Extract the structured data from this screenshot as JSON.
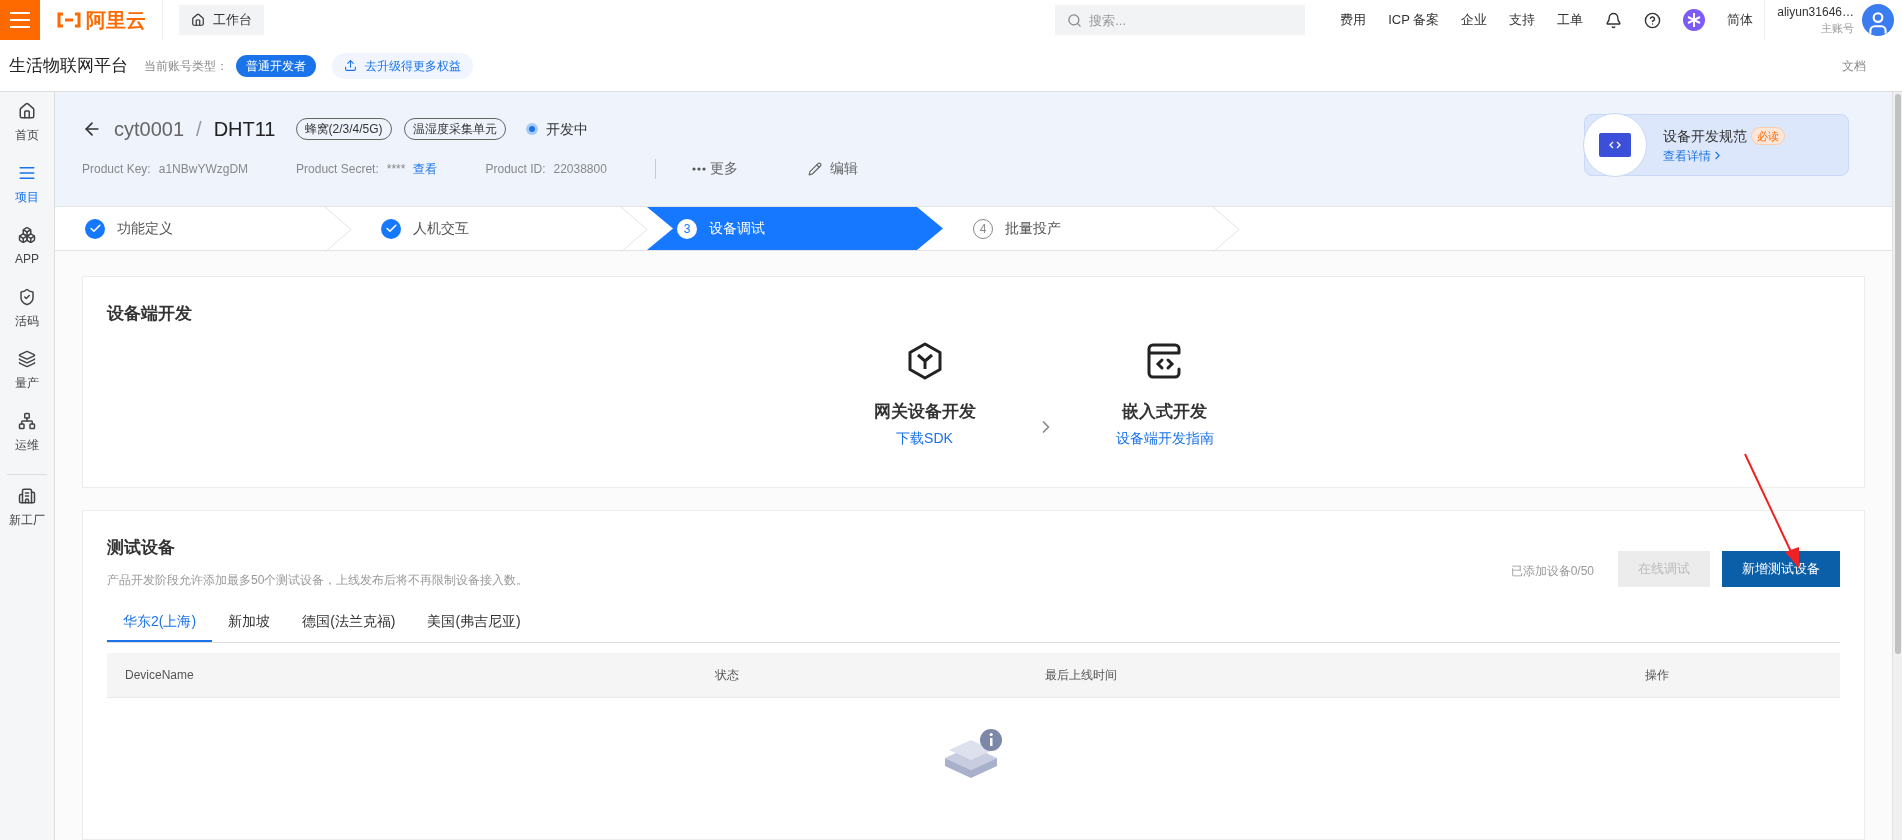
{
  "topbar": {
    "logo": "阿里云",
    "workbench": "工作台",
    "search": {
      "placeholder": "搜索..."
    },
    "links": [
      "费用",
      "ICP 备案",
      "企业",
      "支持",
      "工单"
    ],
    "language": "简体",
    "user": {
      "name": "aliyun31646…",
      "role": "主账号"
    }
  },
  "subheader": {
    "title": "生活物联网平台",
    "account_label": "当前账号类型：",
    "account_type": "普通开发者",
    "upgrade": "去升级得更多权益",
    "docs": "文档"
  },
  "sidebar": {
    "items": [
      {
        "label": "首页",
        "selected": false
      },
      {
        "label": "项目",
        "selected": true
      },
      {
        "label": "APP",
        "selected": false
      },
      {
        "label": "活码",
        "selected": false
      },
      {
        "label": "量产",
        "selected": false
      },
      {
        "label": "运维",
        "selected": false
      },
      {
        "label": "新工厂",
        "selected": false
      }
    ]
  },
  "product": {
    "project": "cyt0001",
    "separator": "/",
    "name": "DHT11",
    "tags": [
      "蜂窝(2/3/4/5G)",
      "温湿度采集单元"
    ],
    "status": "开发中",
    "meta": [
      {
        "label": "Product Key:",
        "value": "a1NBwYWzgDM"
      },
      {
        "label": "Product Secret:",
        "value": "****",
        "link": "查看"
      },
      {
        "label": "Product ID:",
        "value": "22038800"
      }
    ],
    "more": "更多",
    "edit": "编辑",
    "promo": {
      "title": "设备开发规范",
      "badge": "必读",
      "link": "查看详情"
    }
  },
  "steps": [
    {
      "label": "功能定义",
      "completed": true,
      "selected": false
    },
    {
      "label": "人机交互",
      "completed": true,
      "selected": false
    },
    {
      "number": "3",
      "label": "设备调试",
      "completed": false,
      "selected": true
    },
    {
      "number": "4",
      "label": "批量投产",
      "completed": false,
      "selected": false
    }
  ],
  "device_dev": {
    "title": "设备端开发",
    "options": [
      {
        "title": "网关设备开发",
        "link": "下载SDK"
      },
      {
        "title": "嵌入式开发",
        "link": "设备端开发指南"
      }
    ]
  },
  "test_devices": {
    "title": "测试设备",
    "description": "产品开发阶段允许添加最多50个测试设备，上线发布后将不再限制设备接入数。",
    "count": "已添加设备0/50",
    "buttons": [
      {
        "label": "在线调试",
        "disabled": true
      },
      {
        "label": "新增测试设备",
        "disabled": false
      }
    ],
    "tabs": [
      {
        "label": "华东2(上海)",
        "selected": true
      },
      {
        "label": "新加坡",
        "selected": false
      },
      {
        "label": "德国(法兰克福)",
        "selected": false
      },
      {
        "label": "美国(弗吉尼亚)",
        "selected": false
      }
    ],
    "table": {
      "columns": [
        "DeviceName",
        "状态",
        "最后上线时间",
        "操作"
      ]
    }
  }
}
